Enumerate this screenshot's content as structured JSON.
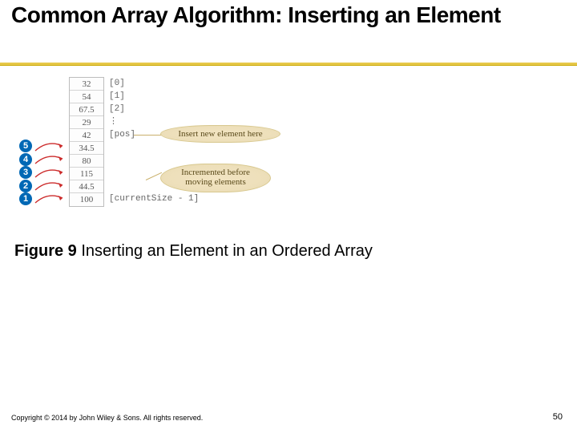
{
  "title": "Common Array Algorithm: Inserting an Element",
  "diagram": {
    "steps": [
      "5",
      "4",
      "3",
      "2",
      "1"
    ],
    "cells": [
      "32",
      "54",
      "67.5",
      "29",
      "42",
      "34.5",
      "80",
      "115",
      "44.5",
      "100"
    ],
    "indices": [
      "[0]",
      "[1]",
      "[2]",
      "⋮",
      "[pos]",
      "",
      "",
      "",
      "",
      "[currentSize - 1]"
    ],
    "callout_top": "Insert new element here",
    "callout_bottom_l1": "Incremented before",
    "callout_bottom_l2": "moving elements"
  },
  "caption": {
    "label": "Figure 9",
    "text": " Inserting an Element in an Ordered Array"
  },
  "footer": {
    "copyright": "Copyright © 2014 by John Wiley & Sons. All rights reserved.",
    "page": "50"
  }
}
